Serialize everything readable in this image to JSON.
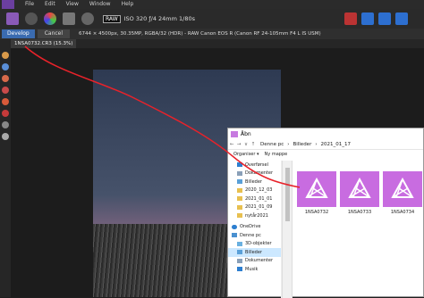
{
  "menu": [
    "File",
    "Edit",
    "View",
    "Window",
    "Help"
  ],
  "toolbar": {
    "raw_badge": "RAW",
    "exposure": "ISO 320 ƒ/4 24mm 1/80s"
  },
  "develop_bar": {
    "develop_label": "Develop",
    "cancel_label": "Cancel",
    "image_info": "6744 × 4500px, 30.35MP, RGBA/32 (HDR) - RAW     Canon EOS R (Canon RF 24-105mm F4 L IS USM)"
  },
  "document_tab": "1NSA0732.CR3 (15.3%)",
  "dialog": {
    "title": "Åbn",
    "breadcrumb": [
      "Denne pc",
      "Billeder",
      "2021_01_17"
    ],
    "commands": [
      "Organiser ▾",
      "Ny mappe"
    ],
    "nav_items": [
      {
        "label": "Overførsel",
        "pinned": true
      },
      {
        "label": "Dokumenter",
        "pinned": true
      },
      {
        "label": "Billeder",
        "pinned": true
      },
      {
        "label": "2020_12_03",
        "pinned": false
      },
      {
        "label": "2021_01_01",
        "pinned": false
      },
      {
        "label": "2021_01_09",
        "pinned": false
      },
      {
        "label": "nytår2021",
        "pinned": false
      },
      {
        "label": "OneDrive",
        "pinned": false
      },
      {
        "label": "Denne pc",
        "pinned": false
      },
      {
        "label": "3D-objekter",
        "pinned": false
      },
      {
        "label": "Billeder",
        "pinned": false
      },
      {
        "label": "Dokumenter",
        "pinned": false
      },
      {
        "label": "Musik",
        "pinned": false
      }
    ],
    "files": [
      "1NSA0732",
      "1NSA0733",
      "1NSA0734"
    ]
  },
  "colors": {
    "accent": "#3a6bb0",
    "annotation": "#e8222a",
    "affinity": "#c86ce0"
  }
}
